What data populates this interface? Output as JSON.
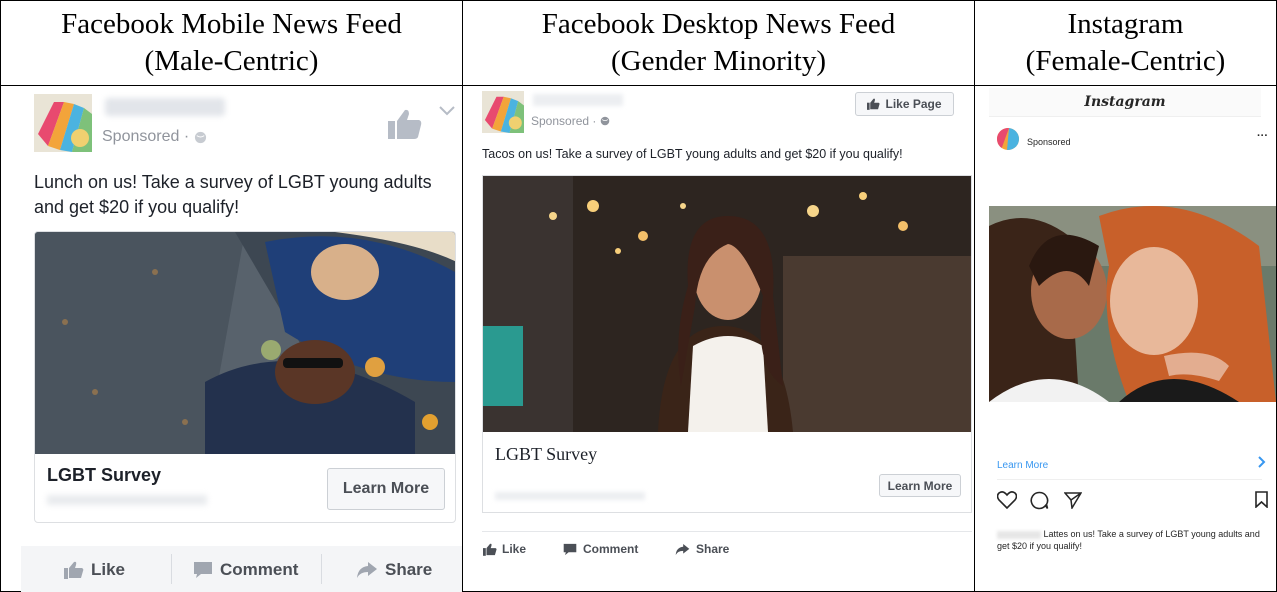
{
  "columns": [
    {
      "title_line1": "Facebook Mobile News Feed",
      "title_line2": "(Male-Centric)"
    },
    {
      "title_line1": "Facebook Desktop News Feed",
      "title_line2": "(Gender Minority)"
    },
    {
      "title_line1": "Instagram",
      "title_line2": "(Female-Centric)"
    }
  ],
  "mobile": {
    "sponsored": "Sponsored ·",
    "post_text": "Lunch on us! Take a survey of LGBT young adults and get $20 if you qualify!",
    "card_title": "LGBT Survey",
    "cta": "Learn More",
    "actions": {
      "like": "Like",
      "comment": "Comment",
      "share": "Share"
    }
  },
  "desktop": {
    "like_page": "Like Page",
    "sponsored": "Sponsored ·",
    "post_text": "Tacos on us! Take a survey of LGBT young adults and get $20 if you qualify!",
    "card_title": "LGBT Survey",
    "cta": "Learn More",
    "actions": {
      "like": "Like",
      "comment": "Comment",
      "share": "Share"
    }
  },
  "instagram": {
    "logo": "Instagram",
    "sponsored": "Sponsored",
    "more": "···",
    "learn_more": "Learn More",
    "caption": "Lattes on us! Take a survey of LGBT young adults and get $20 if you qualify!"
  },
  "colors": {
    "fb_blue": "#4267b2",
    "ig_link": "#3897f0",
    "fb_gray": "#90949c"
  }
}
